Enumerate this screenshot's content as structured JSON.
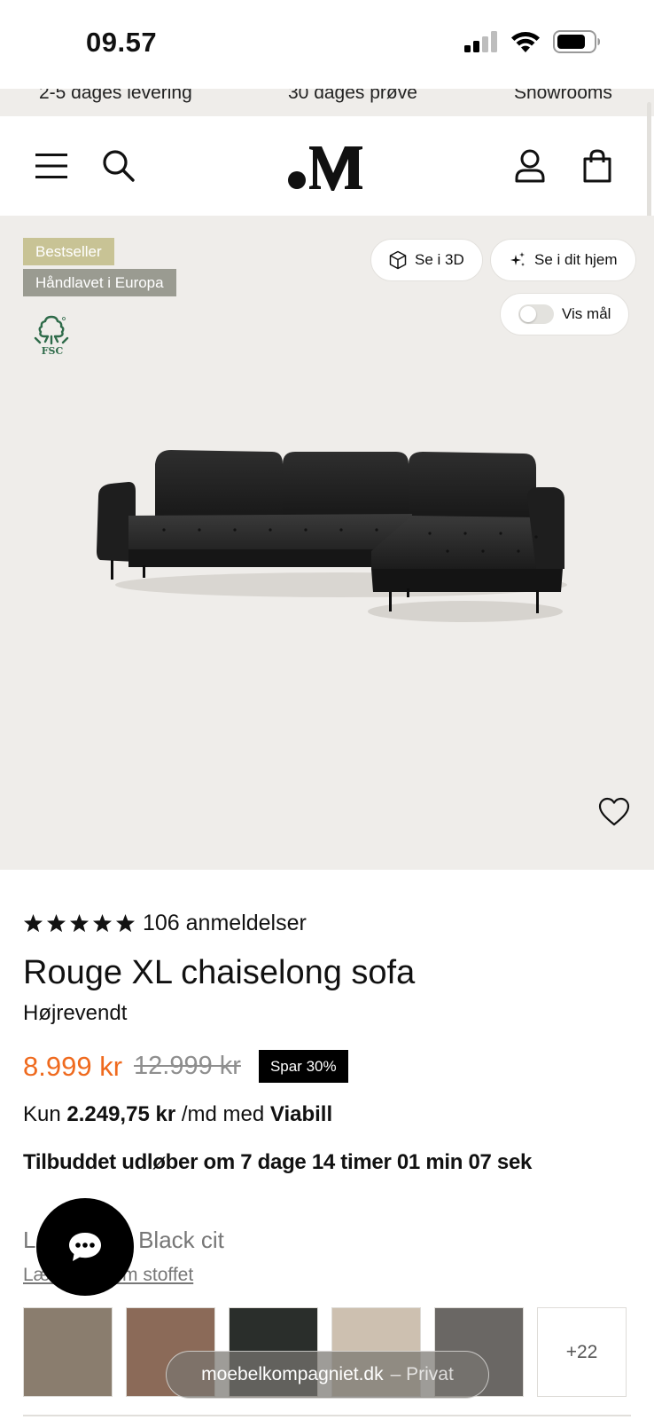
{
  "status_bar": {
    "time": "09.57"
  },
  "promo_strip": {
    "items": [
      "2-5 dages levering",
      "30 dages prøve",
      "Showrooms"
    ]
  },
  "header": {
    "menu_icon": "hamburger-menu-icon",
    "search_icon": "search-icon",
    "logo_icon": "brand-logo",
    "account_icon": "user-icon",
    "cart_icon": "shopping-bag-icon"
  },
  "hero": {
    "badges": [
      "Bestseller",
      "Håndlavet i Europa"
    ],
    "fsc_label": "FSC",
    "view_3d_label": "Se i 3D",
    "view_home_label": "Se i dit hjem",
    "measure_label": "Vis mål",
    "measure_toggle_on": false
  },
  "product": {
    "rating_stars": 5,
    "review_count": "106 anmeldelser",
    "title": "Rouge XL chaiselong sofa",
    "variant": "Højrevendt",
    "price": "8.999 kr",
    "old_price": "12.999 kr",
    "save_badge": "Spar 30%",
    "finance_prefix": "Kun",
    "finance_amount": "2.249,75 kr",
    "finance_mid": "/md med",
    "finance_provider": "Viabill",
    "offer_text": "Tilbuddet udløber om 7 dage 14 timer 01 min 07 sek"
  },
  "fabric": {
    "title": "Lux Velour Black cit",
    "link": "Læs mere om stoffet",
    "swatch_colors": [
      "#8a7d6e",
      "#8b6a58",
      "#2a2e2b",
      "#cdc0b0",
      "#6a6764"
    ],
    "more_label": "+22"
  },
  "browser": {
    "domain": "moebelkompagniet.dk",
    "mode": "– Privat"
  },
  "colors": {
    "accent_price": "#ef6a1e",
    "hero_bg": "#efedea",
    "badge_bestseller": "#c8c395",
    "badge_handmade": "#9a9b91"
  }
}
